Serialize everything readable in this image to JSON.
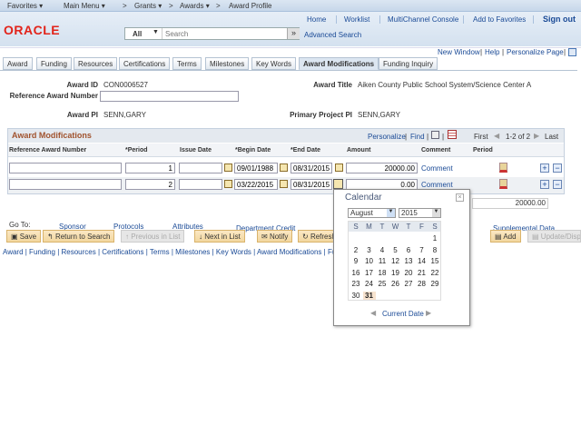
{
  "topnav": {
    "favorites": "Favorites ▾",
    "main_menu": "Main Menu ▾",
    "crumbs": [
      "Grants ▾",
      "Awards ▾",
      "Award Profile"
    ]
  },
  "header": {
    "logo": "ORACLE",
    "links": [
      "Home",
      "Worklist",
      "MultiChannel Console",
      "Add to Favorites",
      "Sign out"
    ],
    "search_scope": "All",
    "search_placeholder": "Search",
    "advanced": "Advanced Search"
  },
  "pagelinks": {
    "new_window": "New Window",
    "help": "Help",
    "personalize": "Personalize Page"
  },
  "tabs": [
    "Award",
    "Funding",
    "Resources",
    "Certifications",
    "Terms",
    "Milestones",
    "Key Words",
    "Award Modifications",
    "Funding Inquiry"
  ],
  "fields": {
    "award_id_label": "Award ID",
    "award_id": "CON0006527",
    "ref_label": "Reference Award Number",
    "ref_value": "",
    "title_label": "Award Title",
    "title": "Aiken County Public School System/Science Center A",
    "pi_label": "Award PI",
    "pi": "SENN,GARY",
    "ppi_label": "Primary Project PI",
    "ppi": "SENN,GARY"
  },
  "grid": {
    "title": "Award Modifications",
    "personalize": "Personalize",
    "find": "Find",
    "first": "First",
    "range": "1-2 of 2",
    "last": "Last",
    "columns": [
      "Reference Award Number",
      "*Period",
      "Issue Date",
      "*Begin Date",
      "*End Date",
      "Amount",
      "Comment",
      "Period"
    ],
    "rows": [
      {
        "ref": "",
        "period": "1",
        "issue": "",
        "begin": "09/01/1988",
        "end": "08/31/2015",
        "amount": "20000.00",
        "comment": "Comment"
      },
      {
        "ref": "",
        "period": "2",
        "issue": "",
        "begin": "03/22/2015",
        "end": "08/31/2015",
        "amount": "0.00",
        "comment": "Comment"
      }
    ],
    "total": "20000.00"
  },
  "goto": {
    "label": "Go To:",
    "links": [
      "Sponsor",
      "Protocols",
      "Attributes",
      "Department Credit",
      "Supplemental Data"
    ]
  },
  "buttons": {
    "save": "Save",
    "return": "Return to Search",
    "prev": "Previous in List",
    "next": "Next in List",
    "notify": "Notify",
    "refresh": "Refresh",
    "add": "Add",
    "update": "Update/Display"
  },
  "footer_links": "Award | Funding | Resources | Certifications | Terms | Milestones | Key Words | Award Modifications | Funding",
  "calendar": {
    "title": "Calendar",
    "month": "August",
    "year": "2015",
    "weekdays": [
      "S",
      "M",
      "T",
      "W",
      "T",
      "F",
      "S"
    ],
    "first_weekday": 6,
    "days_in_month": 31,
    "selected_day": 31,
    "current_date": "Current Date"
  }
}
